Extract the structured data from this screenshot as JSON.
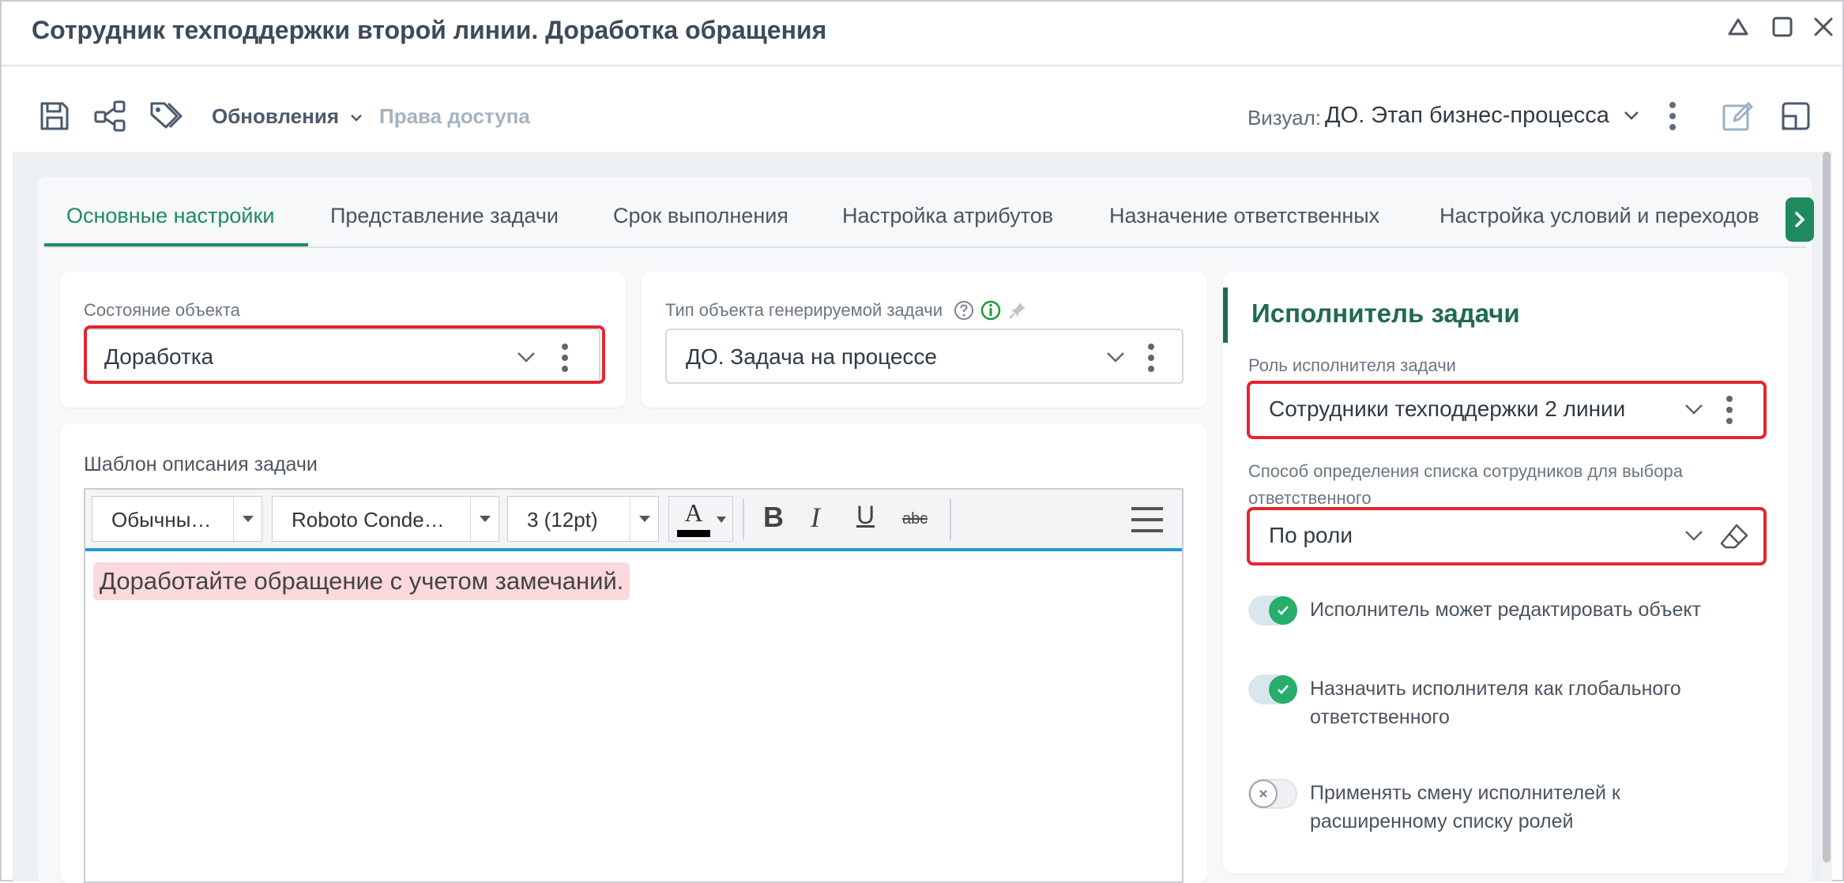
{
  "window": {
    "title": "Сотрудник техподдержки второй линии. Доработка обращения",
    "controls": [
      "collapse-icon",
      "maximize-icon",
      "close-icon"
    ]
  },
  "toolbar": {
    "icons": [
      "save-icon",
      "share-icon",
      "tags-icon"
    ],
    "updates_label": "Обновления",
    "access_rights_label": "Права доступа",
    "visual_label": "Визуал:",
    "visual_value": "ДО. Этап бизнес-процесса",
    "right_icons": [
      "edit-form-icon",
      "layout-icon"
    ]
  },
  "tabs": [
    {
      "label": "Основные настройки",
      "active": true
    },
    {
      "label": "Представление задачи",
      "active": false
    },
    {
      "label": "Срок выполнения",
      "active": false
    },
    {
      "label": "Настройка атрибутов",
      "active": false
    },
    {
      "label": "Назначение ответственных",
      "active": false
    },
    {
      "label": "Настройка условий и переходов",
      "active": false
    }
  ],
  "object_state": {
    "label": "Состояние объекта",
    "value": "Доработка"
  },
  "task_type": {
    "label": "Тип объекта генерируемой задачи",
    "value": "ДО. Задача на процессе"
  },
  "template": {
    "label": "Шаблон описания задачи",
    "style_value": "Обычны…",
    "font_value": "Roboto Conde…",
    "size_value": "3 (12pt)",
    "color_letter": "A",
    "bold": "B",
    "italic": "I",
    "underline": "U",
    "strike": "abc",
    "content": "Доработайте обращение с учетом замечаний."
  },
  "executor": {
    "title": "Исполнитель задачи",
    "role_label": "Роль исполнителя задачи",
    "role_value": "Сотрудники техподдержки 2 линии",
    "method_label_line1": "Способ определения списка сотрудников для выбора",
    "method_label_line2": "ответственного",
    "method_value": "По роли",
    "toggles": [
      {
        "line1": "Исполнитель может редактировать объект",
        "line2": "",
        "on": true
      },
      {
        "line1": "Назначить исполнителя как глобального",
        "line2": "ответственного",
        "on": true
      },
      {
        "line1": "Применять смену исполнителей к",
        "line2": "расширенному списку ролей",
        "on": false
      }
    ]
  },
  "colors": {
    "accent_green": "#1f8a60",
    "highlight_red": "#e3262e",
    "toggle_on": "#27ae6b",
    "content_highlight": "#fbd9dc"
  }
}
